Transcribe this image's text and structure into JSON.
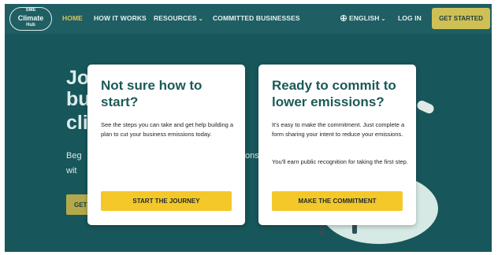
{
  "nav": {
    "logo_top": "SME",
    "logo_mid": "Climate",
    "logo_bottom": "Hub",
    "items": [
      "HOME",
      "HOW IT WORKS",
      "RESOURCES",
      "COMMITTED BUSINESSES"
    ],
    "language": "ENGLISH",
    "login": "LOG IN",
    "cta": "GET STARTED"
  },
  "hero": {
    "heading_lines": [
      "Joi",
      "bu",
      "cli"
    ],
    "sub_left": "Beg",
    "sub_right": "ons",
    "sub_left2": "wit",
    "button": "GET"
  },
  "cards": [
    {
      "title": "Not sure how to start?",
      "body": "See the steps you can take and get help building a plan to cut your business emissions today.",
      "button": "START THE JOURNEY"
    },
    {
      "title": "Ready to commit to lower emissions?",
      "body": "It's easy to make the commitment. Just complete a form sharing your intent to reduce your emissions.",
      "body2": "You'll earn public recognition for taking the first step.",
      "button": "MAKE THE COMMITMENT"
    }
  ],
  "colors": {
    "background": "#17565a",
    "navbar": "#1f5f63",
    "active_nav": "#d9c55a",
    "card_title": "#1b5a57",
    "card_button": "#f5c82a"
  }
}
